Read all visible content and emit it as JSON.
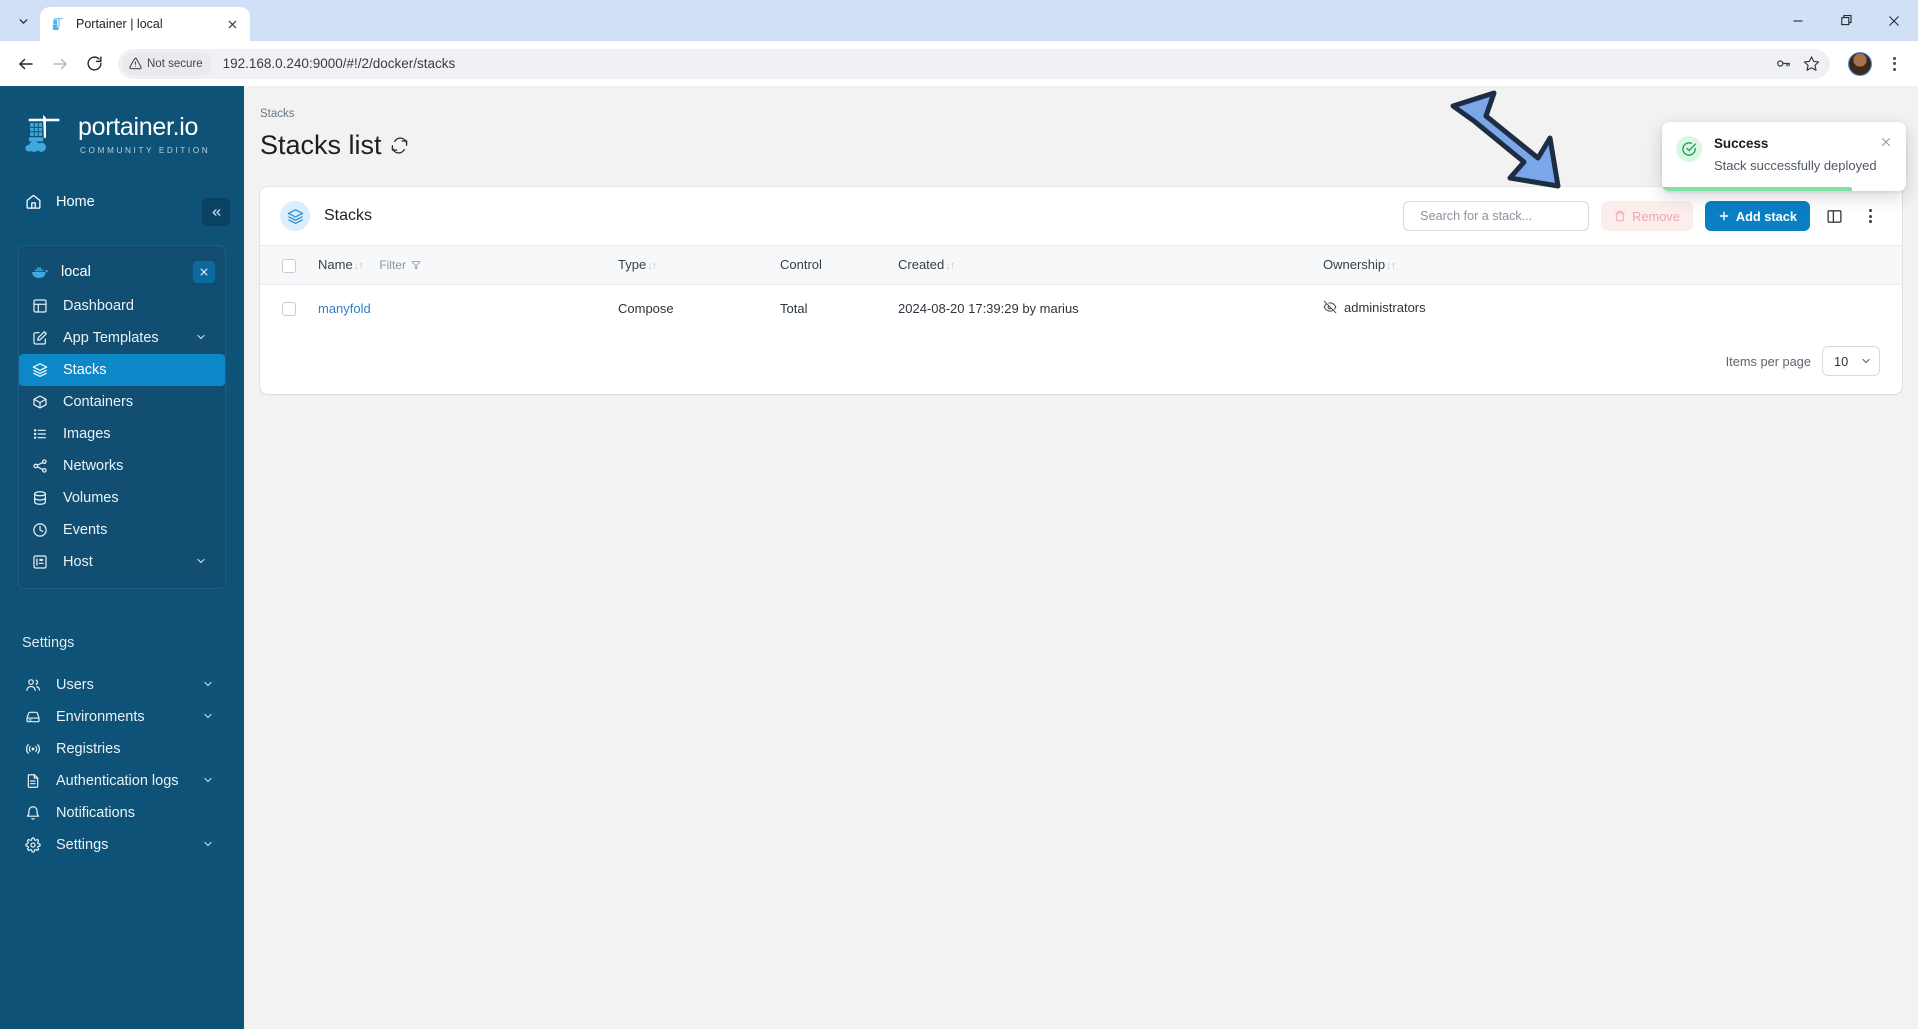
{
  "browser": {
    "tab": {
      "title": "Portainer | local",
      "favicon_icon": "portainer-favicon"
    },
    "tab_list_icon": "chevron-down-icon",
    "tab_close_icon": "close-icon",
    "window": {
      "minimize": "minimize-icon",
      "maximize": "maximize-icon",
      "close": "close-icon"
    },
    "nav": {
      "back": "back-arrow-icon",
      "forward": "forward-arrow-icon",
      "reload": "reload-icon"
    },
    "omnibox": {
      "security_label": "Not secure",
      "security_icon": "warning-triangle-icon",
      "url": "192.168.0.240:9000/#!/2/docker/stacks",
      "password_icon": "key-icon",
      "bookmark_icon": "star-icon"
    },
    "profile_icon": "avatar",
    "menu_icon": "kebab-menu-icon"
  },
  "sidebar": {
    "logo": {
      "main": "portainer.io",
      "sub": "COMMUNITY EDITION",
      "icon": "portainer-crane-logo"
    },
    "collapse_icon": "collapse-chevrons-icon",
    "home": {
      "label": "Home",
      "icon": "home-icon"
    },
    "environment": {
      "name": "local",
      "icon": "docker-whale-icon",
      "close_icon": "close-icon"
    },
    "env_items": [
      {
        "label": "Dashboard",
        "icon": "dashboard-icon",
        "chevron": false,
        "active": false
      },
      {
        "label": "App Templates",
        "icon": "edit-square-icon",
        "chevron": true,
        "active": false
      },
      {
        "label": "Stacks",
        "icon": "layers-icon",
        "chevron": false,
        "active": true
      },
      {
        "label": "Containers",
        "icon": "box-icon",
        "chevron": false,
        "active": false
      },
      {
        "label": "Images",
        "icon": "list-icon",
        "chevron": false,
        "active": false
      },
      {
        "label": "Networks",
        "icon": "share-nodes-icon",
        "chevron": false,
        "active": false
      },
      {
        "label": "Volumes",
        "icon": "database-icon",
        "chevron": false,
        "active": false
      },
      {
        "label": "Events",
        "icon": "clock-icon",
        "chevron": false,
        "active": false
      },
      {
        "label": "Host",
        "icon": "server-panel-icon",
        "chevron": true,
        "active": false
      }
    ],
    "settings_title": "Settings",
    "settings_items": [
      {
        "label": "Users",
        "icon": "users-icon",
        "chevron": true
      },
      {
        "label": "Environments",
        "icon": "environments-icon",
        "chevron": true
      },
      {
        "label": "Registries",
        "icon": "radio-signal-icon",
        "chevron": false
      },
      {
        "label": "Authentication logs",
        "icon": "document-icon",
        "chevron": true
      },
      {
        "label": "Notifications",
        "icon": "bell-icon",
        "chevron": false
      },
      {
        "label": "Settings",
        "icon": "gear-icon",
        "chevron": true
      }
    ]
  },
  "main": {
    "breadcrumb": "Stacks",
    "page_title": "Stacks list",
    "refresh_icon": "refresh-icon",
    "card": {
      "icon": "layers-icon",
      "title": "Stacks",
      "search_placeholder": "Search for a stack...",
      "search_value": "",
      "search_icon": "search-icon",
      "remove_label": "Remove",
      "remove_icon": "trash-icon",
      "add_label": "Add stack",
      "add_icon": "plus-icon",
      "columns_icon": "columns-layout-icon",
      "more_icon": "kebab-menu-icon"
    },
    "table": {
      "select_all_icon": "checkbox",
      "headers": [
        {
          "label": "Name",
          "sortable": true,
          "filter": "Filter",
          "filter_icon": "funnel-icon"
        },
        {
          "label": "Type",
          "sortable": true
        },
        {
          "label": "Control",
          "sortable": false
        },
        {
          "label": "Created",
          "sortable": true
        },
        {
          "label": "Ownership",
          "sortable": true
        }
      ],
      "sort_icon": "sort-arrows-icon",
      "rows": [
        {
          "name": "manyfold",
          "type": "Compose",
          "control": "Total",
          "created": "2024-08-20 17:39:29 by marius",
          "ownership": "administrators",
          "ownership_icon": "eye-off-icon"
        }
      ]
    },
    "footer": {
      "items_per_page_label": "Items per page",
      "items_per_page_value": "10",
      "chevron_icon": "chevron-down-icon"
    }
  },
  "toast": {
    "title": "Success",
    "message": "Stack successfully deployed",
    "status_icon": "check-circle-icon",
    "close_icon": "close-icon"
  },
  "annotation": {
    "arrow_icon": "blue-pointer-arrow"
  },
  "colors": {
    "sidebar_bg": "#0e5277",
    "sidebar_active": "#0c87c8",
    "primary_button": "#0a7fc4",
    "link": "#2f7fce",
    "success": "#22a55b",
    "tabstrip": "#d2e0f7",
    "arrow_fill": "#7ba7e8",
    "arrow_stroke": "#1d2d44"
  }
}
